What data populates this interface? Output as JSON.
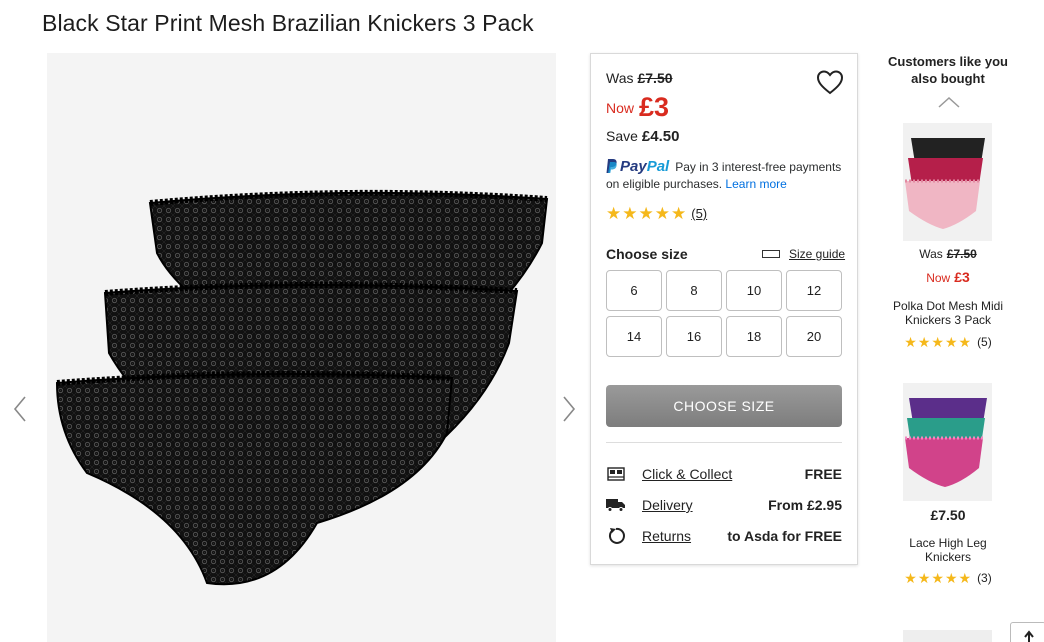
{
  "product": {
    "title": "Black Star Print Mesh Brazilian Knickers 3 Pack"
  },
  "price": {
    "was_label": "Was",
    "was_value": "£7.50",
    "now_label": "Now",
    "now_value": "£3",
    "save_label": "Save",
    "save_value": "£4.50"
  },
  "paypal": {
    "logo_pay": "Pay",
    "logo_pal": "Pal",
    "text": "Pay in 3 interest-free payments on eligible purchases.",
    "learn_more": "Learn more"
  },
  "rating": {
    "stars": 5,
    "count": "(5)"
  },
  "sizes": {
    "label": "Choose size",
    "guide": "Size guide",
    "options": [
      "6",
      "8",
      "10",
      "12",
      "14",
      "16",
      "18",
      "20"
    ]
  },
  "cta": {
    "label": "CHOOSE SIZE"
  },
  "services": [
    {
      "label": "Click & Collect",
      "value": "FREE",
      "icon": "store-icon"
    },
    {
      "label": "Delivery",
      "value": "From £2.95",
      "icon": "truck-icon"
    },
    {
      "label": "Returns",
      "value": "to Asda for FREE",
      "icon": "return-icon"
    }
  ],
  "recommendations": {
    "heading": "Customers like you also bought",
    "items": [
      {
        "was_label": "Was",
        "was_value": "£7.50",
        "now_label": "Now",
        "now_value": "£3",
        "name": "Polka Dot Mesh Midi Knickers 3 Pack",
        "rating_count": "(5)"
      },
      {
        "price": "£7.50",
        "name": "Lace High Leg Knickers",
        "rating_count": "(3)"
      }
    ]
  },
  "colors": {
    "sale_red": "#d92b1f",
    "star_gold": "#f5b81b",
    "cta_grey": "#8a8a8a",
    "paypal_blue": "#253b80",
    "paypal_light": "#179bd7"
  }
}
